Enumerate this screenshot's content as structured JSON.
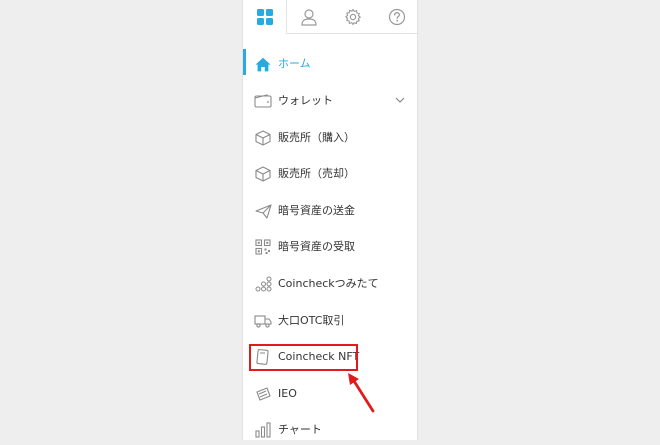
{
  "tabs": [
    {
      "icon": "grid-icon",
      "active": true
    },
    {
      "icon": "user-icon",
      "active": false
    },
    {
      "icon": "gear-icon",
      "active": false
    },
    {
      "icon": "help-icon",
      "active": false
    }
  ],
  "menu": {
    "items": [
      {
        "label": "ホーム",
        "icon": "home-icon",
        "active": true
      },
      {
        "label": "ウォレット",
        "icon": "wallet-icon",
        "expandable": true
      },
      {
        "label": "販売所（購入）",
        "icon": "cube-icon"
      },
      {
        "label": "販売所（売却）",
        "icon": "cube-icon"
      },
      {
        "label": "暗号資産の送金",
        "icon": "paper-plane-icon"
      },
      {
        "label": "暗号資産の受取",
        "icon": "qr-code-icon"
      },
      {
        "label": "Coincheckつみたて",
        "icon": "coins-stack-icon"
      },
      {
        "label": "大口OTC取引",
        "icon": "truck-icon"
      },
      {
        "label": "Coincheck NFT",
        "icon": "nft-card-icon",
        "highlighted": true
      },
      {
        "label": "IEO",
        "icon": "ieo-icon"
      },
      {
        "label": "チャート",
        "icon": "bar-chart-icon"
      }
    ]
  },
  "colors": {
    "accent": "#2aa8e0",
    "highlight_border": "#e11b1b",
    "icon_gray": "#9a9a9a",
    "text": "#333333"
  }
}
